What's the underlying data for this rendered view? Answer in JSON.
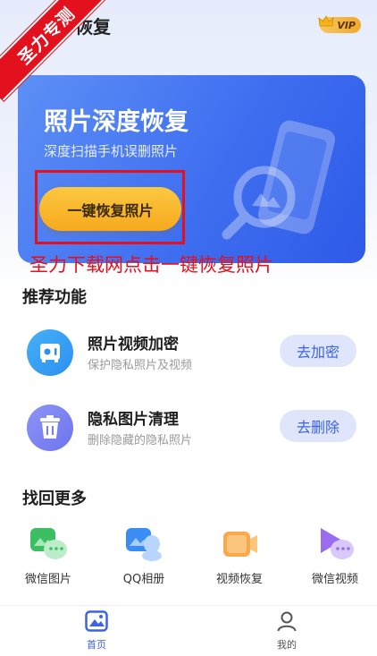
{
  "header": {
    "title": "照片恢复",
    "vip_label": "VIP"
  },
  "watermark": {
    "text": "圣力专测"
  },
  "hero": {
    "title": "照片深度恢复",
    "subtitle": "深度扫描手机误删照片",
    "button_label": "一键恢复照片",
    "annotation": "圣力下载网点击一键恢复照片"
  },
  "recommended": {
    "title": "推荐功能",
    "items": [
      {
        "name": "照片视频加密",
        "desc": "保护隐私照片及视频",
        "button": "去加密",
        "icon": "safe-icon"
      },
      {
        "name": "隐私图片清理",
        "desc": "删除隐藏的隐私照片",
        "button": "去删除",
        "icon": "trash-icon"
      }
    ]
  },
  "more": {
    "title": "找回更多",
    "items": [
      {
        "label": "微信图片",
        "icon": "wechat-image-icon"
      },
      {
        "label": "QQ相册",
        "icon": "qq-album-icon"
      },
      {
        "label": "视频恢复",
        "icon": "video-camera-icon"
      },
      {
        "label": "微信视频",
        "icon": "wechat-video-icon"
      }
    ]
  },
  "tabs": [
    {
      "label": "首页",
      "icon": "photo-home-icon",
      "active": true
    },
    {
      "label": "我的",
      "icon": "user-icon",
      "active": false
    }
  ],
  "colors": {
    "accent": "#3c63e3",
    "hero_bg": "#4474f1",
    "button_gold": "#f6a91e",
    "annotation_red": "#e3111d",
    "muted_text": "#9a9a9a"
  }
}
